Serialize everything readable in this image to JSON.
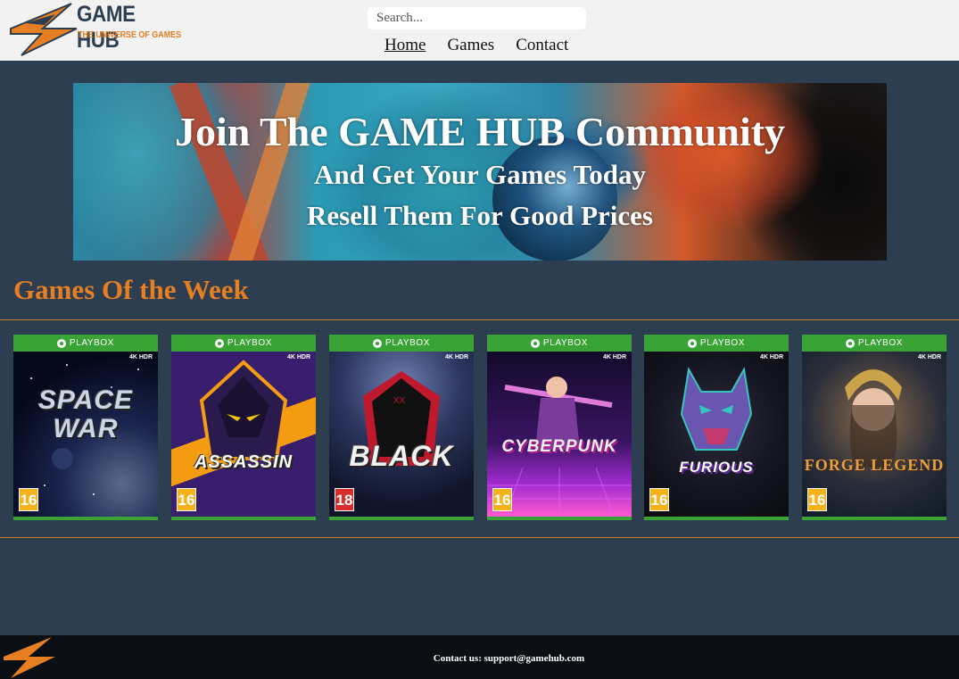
{
  "header": {
    "logo": {
      "title": "GAME HUB",
      "tagline": "THE UNIVERSE OF GAMES",
      "icon": "orange-arrow-logo"
    },
    "search": {
      "placeholder": "Search...",
      "value": ""
    },
    "nav": [
      {
        "label": "Home",
        "active": true
      },
      {
        "label": "Games",
        "active": false
      },
      {
        "label": "Contact",
        "active": false
      }
    ]
  },
  "hero": {
    "line1": "Join The GAME HUB Community",
    "line2": "And Get Your Games Today",
    "line3": "Resell Them For Good Prices"
  },
  "section": {
    "title": "Games Of the Week"
  },
  "games": [
    {
      "platform": "PLAYBOX",
      "spec": "4K HDR",
      "name": "SPACE WAR",
      "age": "16",
      "theme": "space"
    },
    {
      "platform": "PLAYBOX",
      "spec": "4K HDR",
      "name": "ASSASSIN",
      "age": "16",
      "theme": "assassin"
    },
    {
      "platform": "PLAYBOX",
      "spec": "4K HDR",
      "name": "BLACK",
      "age": "18",
      "theme": "black"
    },
    {
      "platform": "PLAYBOX",
      "spec": "4K HDR",
      "name": "CYBERPUNK",
      "age": "16",
      "theme": "cyber"
    },
    {
      "platform": "PLAYBOX",
      "spec": "4K HDR",
      "name": "FURIOUS",
      "age": "16",
      "theme": "furious"
    },
    {
      "platform": "PLAYBOX",
      "spec": "4K HDR",
      "name": "FORGE LEGEND",
      "age": "16",
      "theme": "forge"
    }
  ],
  "footer": {
    "contact": "Contact us: support@gamehub.com"
  },
  "colors": {
    "accent": "#e67e22",
    "background": "#2c3e50",
    "header": "#f2f2f2",
    "footer": "#0b0f14",
    "platform_green": "#3aa336"
  }
}
